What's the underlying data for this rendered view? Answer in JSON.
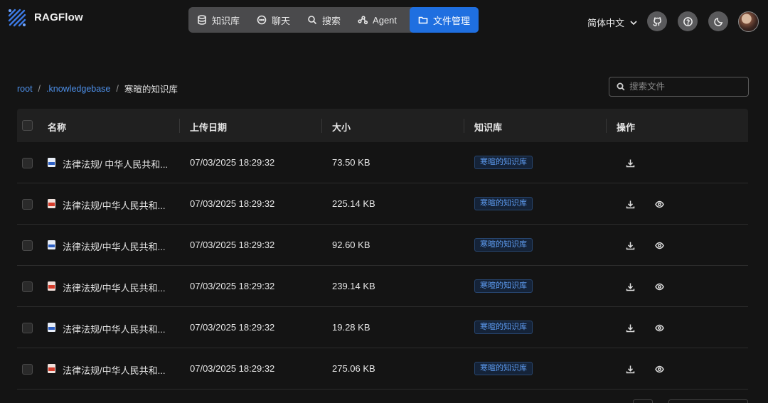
{
  "header": {
    "brand": "RAGFlow",
    "nav": [
      {
        "label": "知识库",
        "icon": "database-icon",
        "active": false
      },
      {
        "label": "聊天",
        "icon": "chat-icon",
        "active": false
      },
      {
        "label": "搜索",
        "icon": "search-icon",
        "active": false
      },
      {
        "label": "Agent",
        "icon": "agent-graph-icon",
        "active": false
      },
      {
        "label": "文件管理",
        "icon": "folder-icon",
        "active": true
      }
    ],
    "language": "简体中文",
    "accent_color": "#1f6fe0"
  },
  "breadcrumb": {
    "root": "root",
    "kb": ".knowledgebase",
    "current": "寒暄的知识库"
  },
  "search": {
    "placeholder": "搜索文件"
  },
  "table": {
    "columns": {
      "name": "名称",
      "date": "上传日期",
      "size": "大小",
      "kb": "知识库",
      "actions": "操作"
    },
    "rows": [
      {
        "name": "法律法规/ 中华人民共和...",
        "type": "doc",
        "date": "07/03/2025 18:29:32",
        "size": "73.50 KB",
        "kb": "寒暄的知识库",
        "preview": false
      },
      {
        "name": "法律法规/中华人民共和...",
        "type": "pdf",
        "date": "07/03/2025 18:29:32",
        "size": "225.14 KB",
        "kb": "寒暄的知识库",
        "preview": true
      },
      {
        "name": "法律法规/中华人民共和...",
        "type": "doc",
        "date": "07/03/2025 18:29:32",
        "size": "92.60 KB",
        "kb": "寒暄的知识库",
        "preview": true
      },
      {
        "name": "法律法规/中华人民共和...",
        "type": "pdf",
        "date": "07/03/2025 18:29:32",
        "size": "239.14 KB",
        "kb": "寒暄的知识库",
        "preview": true
      },
      {
        "name": "法律法规/中华人民共和...",
        "type": "doc",
        "date": "07/03/2025 18:29:32",
        "size": "19.28 KB",
        "kb": "寒暄的知识库",
        "preview": true
      },
      {
        "name": "法律法规/中华人民共和...",
        "type": "pdf",
        "date": "07/03/2025 18:29:32",
        "size": "275.06 KB",
        "kb": "寒暄的知识库",
        "preview": true
      }
    ]
  }
}
